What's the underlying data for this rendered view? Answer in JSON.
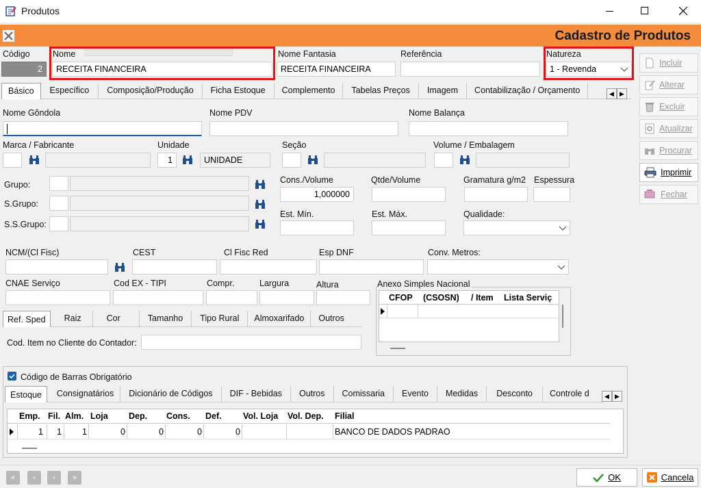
{
  "window": {
    "title": "Produtos"
  },
  "header": {
    "title": "Cadastro de Produtos"
  },
  "top": {
    "codigo_label": "Código",
    "codigo_value": "2",
    "nome_label": "Nome",
    "nome_value": "RECEITA FINANCEIRA",
    "fantasia_label": "Nome Fantasia",
    "fantasia_value": "RECEITA FINANCEIRA",
    "referencia_label": "Referência",
    "referencia_value": "",
    "natureza_label": "Natureza",
    "natureza_value": "1 - Revenda"
  },
  "main_tabs": [
    "Básico",
    "Específico",
    "Composição/Produção",
    "Ficha Estoque",
    "Complemento",
    "Tabelas Preços",
    "Imagem",
    "Contabilização / Orçamento"
  ],
  "basico": {
    "nome_gondola": "Nome Gôndola",
    "nome_pdv": "Nome PDV",
    "nome_balanca": "Nome Balança",
    "marca": "Marca / Fabricante",
    "unidade": "Unidade",
    "unidade_code": "1",
    "unidade_desc": "UNIDADE",
    "secao": "Seção",
    "volume": "Volume / Embalagem",
    "grupo": "Grupo:",
    "sgrupo": "S.Grupo:",
    "ssgrupo": "S.S.Grupo:",
    "cons_volume": "Cons./Volume",
    "cons_volume_value": "1,000000",
    "qtde_volume": "Qtde/Volume",
    "gramatura": "Gramatura g/m2",
    "espessura": "Espessura",
    "est_min": "Est. Mín.",
    "est_max": "Est. Máx.",
    "qualidade": "Qualidade:",
    "ncm": "NCM/(Cl Fisc)",
    "cest": "CEST",
    "cl_fisc_red": "Cl Fisc Red",
    "esp_dnf": "Esp DNF",
    "conv_metros": "Conv. Metros:",
    "cnae": "CNAE Serviço",
    "cod_ex": "Cod EX - TIPI",
    "compr": "Compr.",
    "largura": "Largura",
    "altura": "Altura",
    "anexo": "Anexo Simples Nacional",
    "anexo_cols": [
      "CFOP",
      "(CSOSN)",
      "/ Item",
      "Lista Serviç"
    ],
    "cod_item": "Cod. Item no Cliente do Contador:"
  },
  "sub_tabs": [
    "Ref. Sped",
    "Raiz",
    "Cor",
    "Tamanho",
    "Tipo Rural",
    "Almoxarifado",
    "Outros"
  ],
  "barras": {
    "label": "Código de Barras Obrigatório"
  },
  "bottom_tabs": [
    "Estoque",
    "Consignatários",
    "Dicionário de Códigos",
    "DIF - Bebidas",
    "Outros",
    "Comissaria",
    "Evento",
    "Medidas",
    "Desconto",
    "Controle de"
  ],
  "stock": {
    "columns": [
      "Emp.",
      "Fil.",
      "Alm.",
      "Loja",
      "Dep.",
      "Cons.",
      "Def.",
      "Vol. Loja",
      "Vol. Dep.",
      "Filial"
    ],
    "rows": [
      [
        "1",
        "1",
        "1",
        "0",
        "0",
        "0",
        "0",
        "",
        "",
        "BANCO DE DADOS PADRAO"
      ]
    ]
  },
  "side_buttons": [
    "Incluir",
    "Alterar",
    "Excluir",
    "Atualizar",
    "Procurar",
    "Imprimir",
    "Fechar"
  ],
  "footer": {
    "ok": "OK",
    "cancel": "Cancela"
  },
  "colors": {
    "accent": "#f58c3c",
    "highlight": "#e0141c"
  }
}
